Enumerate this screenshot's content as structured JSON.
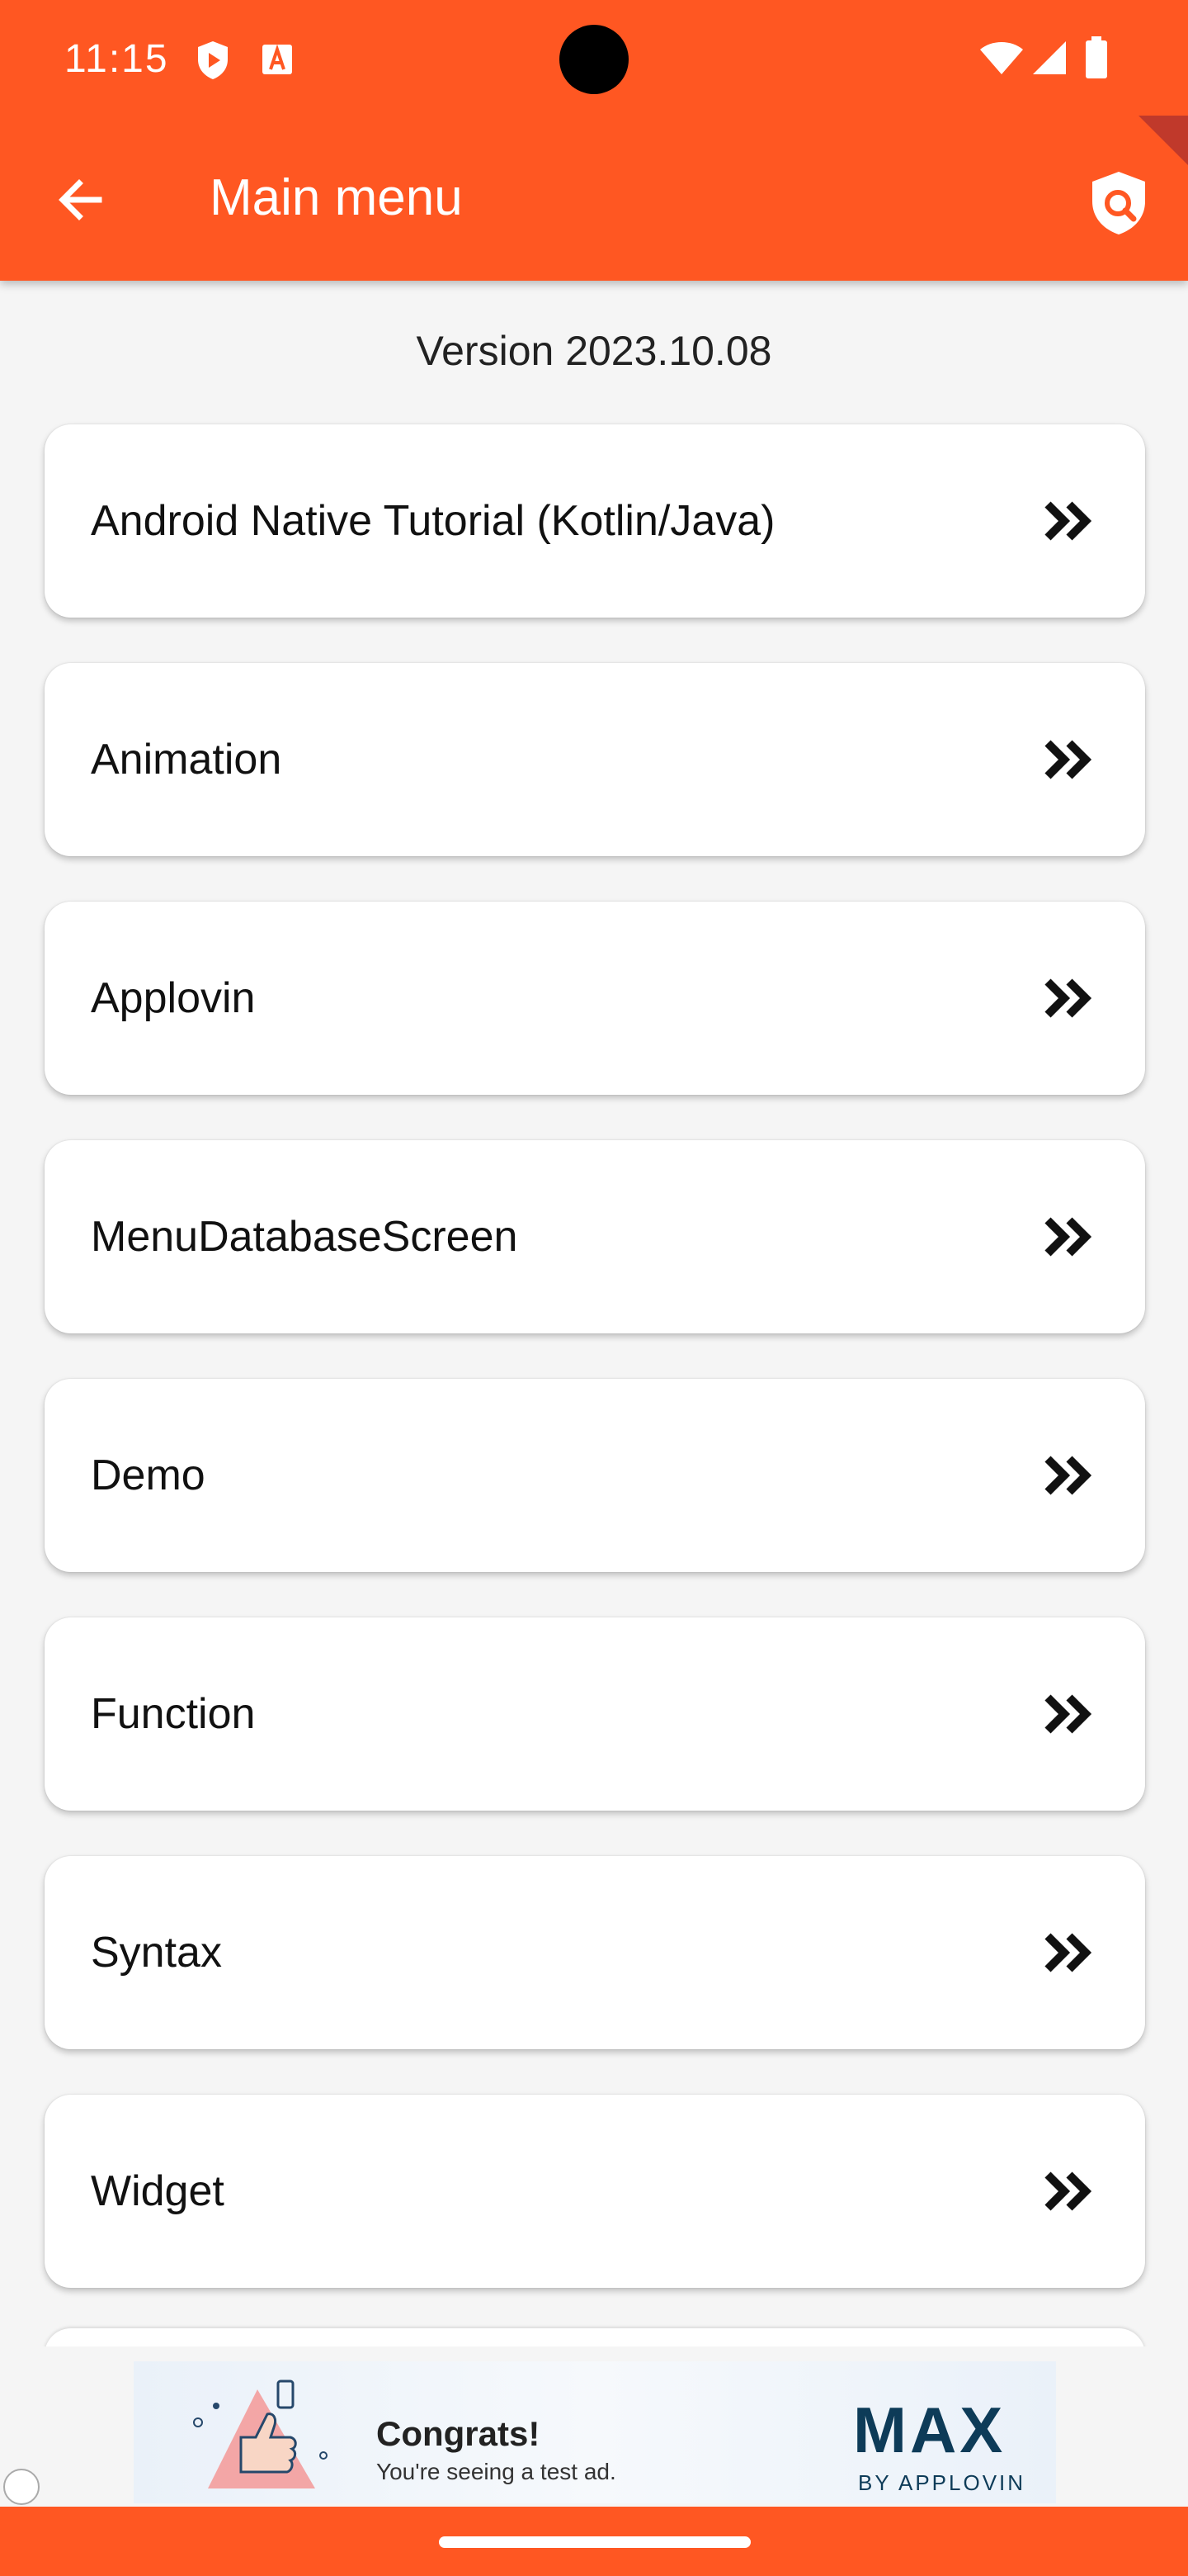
{
  "status_bar": {
    "time": "11:15",
    "icons": [
      "shield-play-icon",
      "font-a-icon",
      "wifi-icon",
      "signal-icon",
      "battery-icon"
    ]
  },
  "app_bar": {
    "title": "Main menu",
    "back_icon": "arrow-left-icon",
    "action_icon": "shield-search-icon",
    "background_color": "#ff5722"
  },
  "version_text": "Version 2023.10.08",
  "menu_items": [
    {
      "label": "Android Native Tutorial (Kotlin/Java)"
    },
    {
      "label": "Animation"
    },
    {
      "label": "Applovin"
    },
    {
      "label": "MenuDatabaseScreen"
    },
    {
      "label": "Demo"
    },
    {
      "label": "Function"
    },
    {
      "label": "Syntax"
    },
    {
      "label": "Widget"
    }
  ],
  "ad": {
    "headline": "Congrats!",
    "subtext": "You're seeing a test ad.",
    "brand": "MAX",
    "brand_sub": "BY APPLOVIN"
  }
}
